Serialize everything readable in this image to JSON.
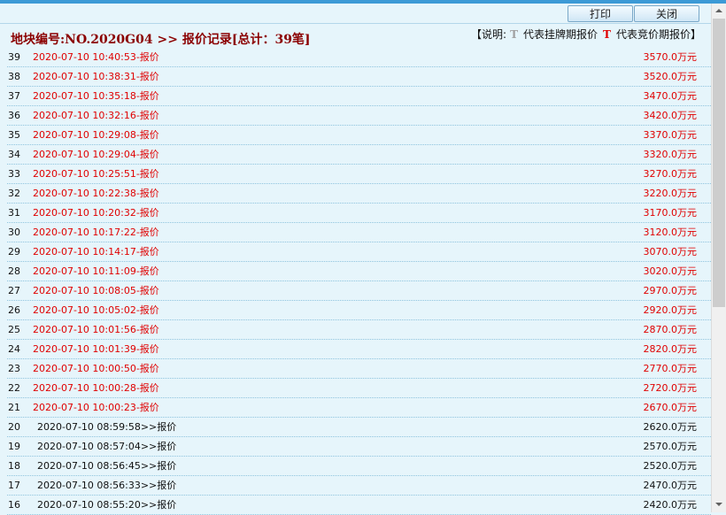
{
  "toolbar": {
    "print_label": "打印",
    "close_label": "关闭"
  },
  "header": {
    "title": "地块编号:NO.2020G04 >> 报价记录[总计：39笔]",
    "legend_prefix": "【说明:",
    "legend_gray_icon": "T",
    "legend_gray_text": "代表挂牌期报价",
    "legend_red_icon": "T",
    "legend_red_text": "代表竞价期报价】"
  },
  "rows": [
    {
      "num": "39",
      "time": "2020-07-10 10:40:53-报价",
      "price": "3570.0万元",
      "kind": "bid"
    },
    {
      "num": "38",
      "time": "2020-07-10 10:38:31-报价",
      "price": "3520.0万元",
      "kind": "bid"
    },
    {
      "num": "37",
      "time": "2020-07-10 10:35:18-报价",
      "price": "3470.0万元",
      "kind": "bid"
    },
    {
      "num": "36",
      "time": "2020-07-10 10:32:16-报价",
      "price": "3420.0万元",
      "kind": "bid"
    },
    {
      "num": "35",
      "time": "2020-07-10 10:29:08-报价",
      "price": "3370.0万元",
      "kind": "bid"
    },
    {
      "num": "34",
      "time": "2020-07-10 10:29:04-报价",
      "price": "3320.0万元",
      "kind": "bid"
    },
    {
      "num": "33",
      "time": "2020-07-10 10:25:51-报价",
      "price": "3270.0万元",
      "kind": "bid"
    },
    {
      "num": "32",
      "time": "2020-07-10 10:22:38-报价",
      "price": "3220.0万元",
      "kind": "bid"
    },
    {
      "num": "31",
      "time": "2020-07-10 10:20:32-报价",
      "price": "3170.0万元",
      "kind": "bid"
    },
    {
      "num": "30",
      "time": "2020-07-10 10:17:22-报价",
      "price": "3120.0万元",
      "kind": "bid"
    },
    {
      "num": "29",
      "time": "2020-07-10 10:14:17-报价",
      "price": "3070.0万元",
      "kind": "bid"
    },
    {
      "num": "28",
      "time": "2020-07-10 10:11:09-报价",
      "price": "3020.0万元",
      "kind": "bid"
    },
    {
      "num": "27",
      "time": "2020-07-10 10:08:05-报价",
      "price": "2970.0万元",
      "kind": "bid"
    },
    {
      "num": "26",
      "time": "2020-07-10 10:05:02-报价",
      "price": "2920.0万元",
      "kind": "bid"
    },
    {
      "num": "25",
      "time": "2020-07-10 10:01:56-报价",
      "price": "2870.0万元",
      "kind": "bid"
    },
    {
      "num": "24",
      "time": "2020-07-10 10:01:39-报价",
      "price": "2820.0万元",
      "kind": "bid"
    },
    {
      "num": "23",
      "time": "2020-07-10 10:00:50-报价",
      "price": "2770.0万元",
      "kind": "bid"
    },
    {
      "num": "22",
      "time": "2020-07-10 10:00:28-报价",
      "price": "2720.0万元",
      "kind": "bid"
    },
    {
      "num": "21",
      "time": "2020-07-10 10:00:23-报价",
      "price": "2670.0万元",
      "kind": "bid"
    },
    {
      "num": "20",
      "time": "2020-07-10 08:59:58>>报价",
      "price": "2620.0万元",
      "kind": "list-type"
    },
    {
      "num": "19",
      "time": "2020-07-10 08:57:04>>报价",
      "price": "2570.0万元",
      "kind": "list-type"
    },
    {
      "num": "18",
      "time": "2020-07-10 08:56:45>>报价",
      "price": "2520.0万元",
      "kind": "list-type"
    },
    {
      "num": "17",
      "time": "2020-07-10 08:56:33>>报价",
      "price": "2470.0万元",
      "kind": "list-type"
    },
    {
      "num": "16",
      "time": "2020-07-10 08:55:20>>报价",
      "price": "2420.0万元",
      "kind": "list-type"
    }
  ]
}
